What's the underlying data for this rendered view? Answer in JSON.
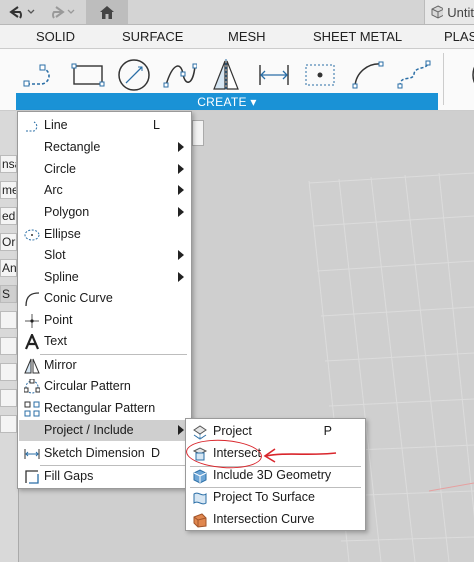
{
  "window": {
    "doc_title": "Untit"
  },
  "ribbon": {
    "tabs": [
      {
        "label": "SOLID"
      },
      {
        "label": "SURFACE"
      },
      {
        "label": "MESH"
      },
      {
        "label": "SHEET METAL"
      },
      {
        "label": "PLAST"
      }
    ],
    "create_label": "CREATE ▾",
    "tools": [
      "line-tool-icon",
      "rectangle-tool-icon",
      "circle-tool-icon",
      "spline-tool-icon",
      "mirror-tool-icon",
      "sketch-dimension-tool-icon",
      "point-tool-icon",
      "arc-tool-icon",
      "curve-tool-icon"
    ]
  },
  "left_panel": {
    "items": [
      "nsa",
      "me",
      "ed",
      "Ori",
      "An",
      "S",
      "",
      "",
      "",
      "",
      ""
    ]
  },
  "create_menu": {
    "items": [
      {
        "label": "Line",
        "shortcut": "L",
        "submenu": false
      },
      {
        "label": "Rectangle",
        "shortcut": "",
        "submenu": true
      },
      {
        "label": "Circle",
        "shortcut": "",
        "submenu": true
      },
      {
        "label": "Arc",
        "shortcut": "",
        "submenu": true
      },
      {
        "label": "Polygon",
        "shortcut": "",
        "submenu": true
      },
      {
        "label": "Ellipse",
        "shortcut": "",
        "submenu": false
      },
      {
        "label": "Slot",
        "shortcut": "",
        "submenu": true
      },
      {
        "label": "Spline",
        "shortcut": "",
        "submenu": true
      },
      {
        "label": "Conic Curve",
        "shortcut": "",
        "submenu": false
      },
      {
        "label": "Point",
        "shortcut": "",
        "submenu": false
      },
      {
        "label": "Text",
        "shortcut": "",
        "submenu": false
      },
      {
        "label": "Mirror",
        "shortcut": "",
        "submenu": false
      },
      {
        "label": "Circular Pattern",
        "shortcut": "",
        "submenu": false
      },
      {
        "label": "Rectangular Pattern",
        "shortcut": "",
        "submenu": false
      },
      {
        "label": "Project / Include",
        "shortcut": "",
        "submenu": true,
        "highlighted": true
      },
      {
        "label": "Sketch Dimension",
        "shortcut": "D",
        "submenu": false
      },
      {
        "label": "Fill Gaps",
        "shortcut": "",
        "submenu": false
      }
    ]
  },
  "project_submenu": {
    "items": [
      {
        "label": "Project",
        "shortcut": "P"
      },
      {
        "label": "Intersect",
        "shortcut": ""
      },
      {
        "label": "Include 3D Geometry",
        "shortcut": ""
      },
      {
        "label": "Project To Surface",
        "shortcut": ""
      },
      {
        "label": "Intersection Curve",
        "shortcut": ""
      }
    ]
  },
  "colors": {
    "accent": "#1a92d6",
    "annotation": "#d9262c",
    "highlight": "#cfcfcf"
  }
}
